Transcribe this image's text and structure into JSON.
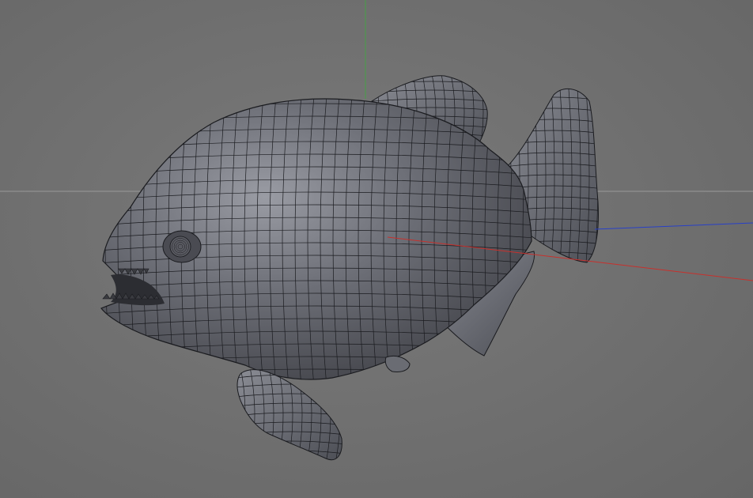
{
  "viewport": {
    "background": "#727272",
    "grid_line_color": "#9a9a9a"
  },
  "axes": {
    "x_color": "#c8302c",
    "y_color": "#46a046",
    "z_color": "#2840c8"
  },
  "model": {
    "mesh_fill": "#5d5f66",
    "mesh_light": "#8c8e96",
    "wire_color": "#1a1b1f",
    "shading": "gouraud-with-wireframe",
    "teeth_color": "#3a3b40"
  }
}
